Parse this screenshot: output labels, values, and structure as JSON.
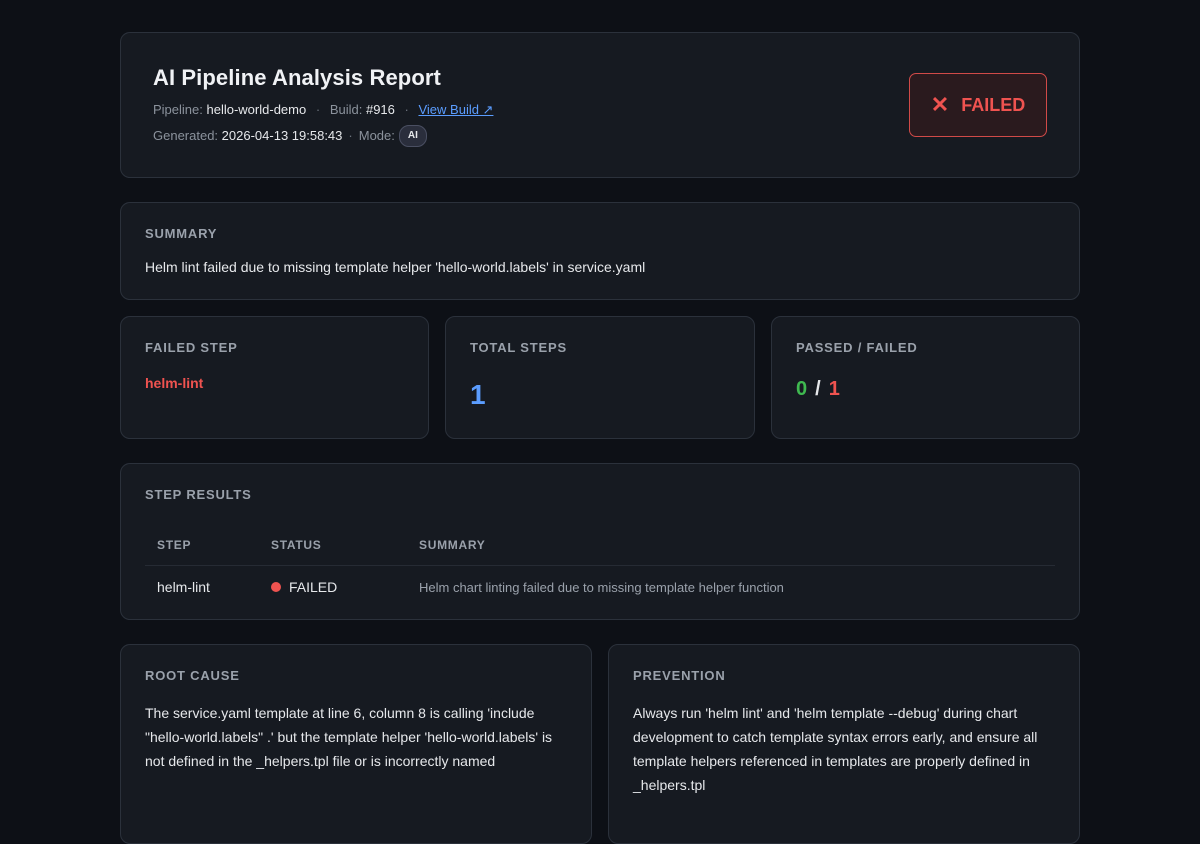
{
  "header": {
    "title": "AI Pipeline Analysis Report",
    "pipeline_label": "Pipeline:",
    "pipeline_value": "hello-world-demo",
    "build_label": "Build:",
    "build_value": "#916",
    "separator": "·",
    "view_build_link": "View Build ↗",
    "generated_label": "Generated:",
    "generated_value": "2026-04-13 19:58:43",
    "mode_label": "Mode:",
    "mode_value": "AI",
    "status": "FAILED",
    "status_icon": "✕"
  },
  "summary": {
    "label": "SUMMARY",
    "text": "Helm lint failed due to missing template helper 'hello-world.labels' in service.yaml"
  },
  "stats": {
    "failed_step_label": "FAILED STEP",
    "failed_step_value": "helm-lint",
    "total_steps_label": "TOTAL STEPS",
    "total_steps_value": "1",
    "passed_failed_label": "PASSED / FAILED",
    "passed": "0",
    "slash": "/",
    "failed": "1"
  },
  "step_results": {
    "label": "STEP RESULTS",
    "columns": [
      "STEP",
      "STATUS",
      "SUMMARY"
    ],
    "rows": [
      {
        "step": "helm-lint",
        "status": "FAILED",
        "summary": "Helm chart linting failed due to missing template helper function"
      }
    ]
  },
  "root_cause": {
    "label": "ROOT CAUSE",
    "text": "The service.yaml template at line 6, column 8 is calling 'include \"hello-world.labels\" .' but the template helper 'hello-world.labels' is not defined in the _helpers.tpl file or is incorrectly named"
  },
  "prevention": {
    "label": "PREVENTION",
    "text": "Always run 'helm lint' and 'helm template --debug' during chart development to catch template syntax errors early, and ensure all template helpers referenced in templates are properly defined in _helpers.tpl"
  },
  "colors": {
    "background": "#0d1016",
    "card": "#161a21",
    "accent_blue": "#5b9dff",
    "failed_red": "#ef5350",
    "passed_green": "#3fb950"
  },
  "icons": {
    "status": "close-x-icon",
    "status_dot": "red-dot-icon",
    "external_link": "external-link-arrow"
  }
}
